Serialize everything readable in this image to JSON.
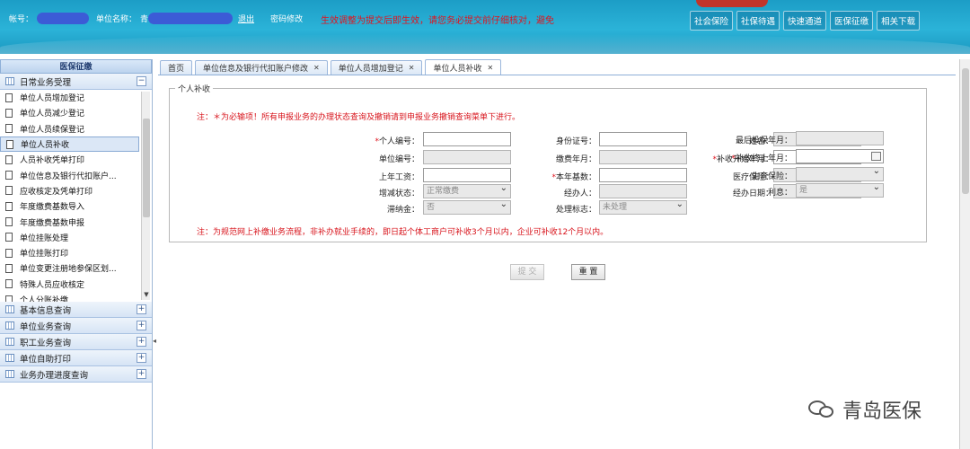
{
  "header": {
    "account_label": "帐号：",
    "unit_label": "单位名称：",
    "unit_prefix": "青",
    "logout": "退出",
    "change_password": "密码修改",
    "notice": "生效调整为提交后即生效，请您务必提交前仔细核对，避免",
    "links": [
      "社会保险",
      "社保待遇",
      "快速通道",
      "医保征缴",
      "相关下载"
    ]
  },
  "sidebar": {
    "title": "医保征缴",
    "active_section": "日常业务受理",
    "items": [
      "单位人员增加登记",
      "单位人员减少登记",
      "单位人员续保登记",
      "单位人员补收",
      "人员补收凭单打印",
      "单位信息及银行代扣账户...",
      "应收核定及凭单打印",
      "年度缴费基数导入",
      "年度缴费基数申报",
      "单位挂账处理",
      "单位挂账打印",
      "单位变更注册地参保区划...",
      "特殊人员应收核定",
      "个人分账补缴"
    ],
    "active_item": "单位人员补收",
    "sections": [
      "基本信息查询",
      "单位业务查询",
      "职工业务查询",
      "单位自助打印",
      "业务办理进度查询"
    ]
  },
  "tabs": [
    {
      "label": "首页",
      "closable": false
    },
    {
      "label": "单位信息及银行代扣账户修改",
      "closable": true
    },
    {
      "label": "单位人员增加登记",
      "closable": true
    },
    {
      "label": "单位人员补收",
      "closable": true,
      "active": true
    }
  ],
  "form": {
    "legend": "个人补收",
    "note_top": "注：＊为必输项！所有申报业务的办理状态查询及撤销请到申报业务撤销查询菜单下进行。",
    "note_bottom": "注：为规范网上补缴业务流程，非补办就业手续的，即日起个体工商户可补收3个月以内，企业可补收12个月以内。",
    "labels": {
      "person_no": "个人编号：",
      "id_no": "身份证号：",
      "name": "姓名：",
      "last_month": "最后投保年月：",
      "unit_no": "单位编号：",
      "pay_month": "缴费年月：",
      "start_month": "补收开始年月：",
      "end_month": "补收终止年月：",
      "last_salary": "上年工资：",
      "base": "本年基数：",
      "medical": "医疗保险：",
      "maternity": "生育保险：",
      "status": "增减状态：",
      "handler": "经办人：",
      "handle_date": "经办日期：",
      "interest": "利息：",
      "late_fee": "滞纳金：",
      "process_flag": "处理标志："
    },
    "values": {
      "status": "正常缴费",
      "interest": "是",
      "late_fee": "否",
      "process_flag": "未处理"
    },
    "submit": "提 交",
    "reset": "重 置"
  },
  "watermark": {
    "text": "青岛医保"
  },
  "colors": {
    "header_bg": "#1c9dc6",
    "notice_red": "#e0141e",
    "sidebar_blue": "#d6e4f5"
  }
}
